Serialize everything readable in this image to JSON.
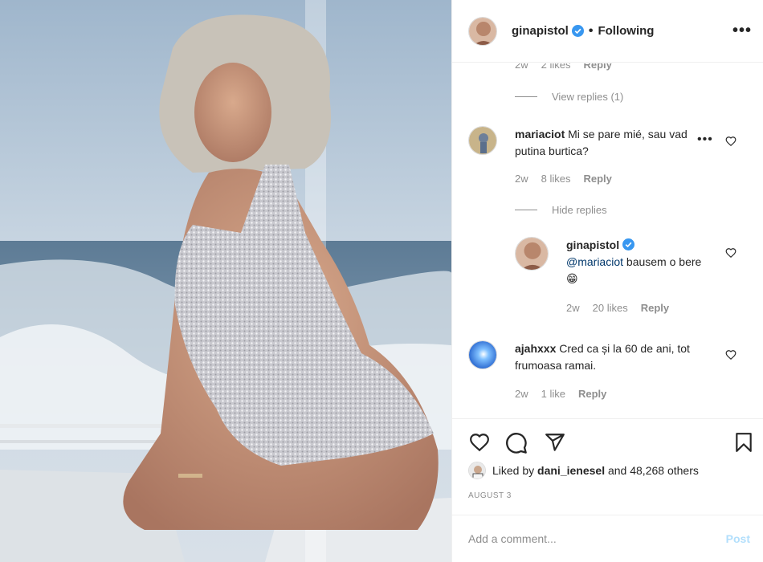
{
  "post": {
    "author": "ginapistol",
    "follow_status": "Following",
    "date": "AUGUST 3",
    "likes_prefix": "Liked by",
    "likes_user": "dani_ienesel",
    "likes_suffix": "and 48,268 others"
  },
  "comments": [
    {
      "meta": {
        "time": "2w",
        "likes": "2 likes",
        "reply": "Reply"
      },
      "view_replies": "View replies (1)"
    },
    {
      "user": "mariaciot",
      "text": "Mi se pare mié, sau vad putina burtica?",
      "meta": {
        "time": "2w",
        "likes": "8 likes",
        "reply": "Reply"
      },
      "hide_replies": "Hide replies",
      "reply": {
        "user": "ginapistol",
        "mention": "@mariaciot",
        "text": " bausem o bere 😁",
        "meta": {
          "time": "2w",
          "likes": "20 likes",
          "reply": "Reply"
        }
      }
    },
    {
      "user": "ajahxxx",
      "text": "Cred ca și la 60 de ani, tot frumoasa ramai.",
      "meta": {
        "time": "2w",
        "likes": "1 like",
        "reply": "Reply"
      }
    }
  ],
  "composer": {
    "placeholder": "Add a comment...",
    "post_label": "Post"
  },
  "colors": {
    "verified": "#3897f0",
    "link": "#00376b",
    "muted": "#8e8e8e",
    "post_disabled": "#b2dffc"
  }
}
